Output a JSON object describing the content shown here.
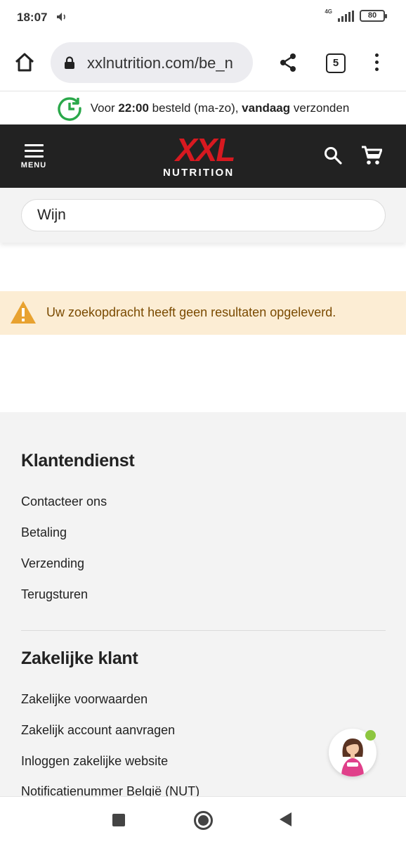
{
  "status_bar": {
    "time": "18:07",
    "network": "4G",
    "battery": "80",
    "icons": [
      "volume-icon",
      "signal-icon",
      "battery-icon"
    ]
  },
  "browser": {
    "url": "xxlnutrition.com/be_n",
    "tab_count": "5",
    "icons": [
      "home-icon",
      "lock-icon",
      "share-icon",
      "tabs-icon",
      "more-icon"
    ]
  },
  "shipping_banner": {
    "prefix": "Voor ",
    "time": "22:00",
    "middle": " besteld (ma-zo), ",
    "emphasis": "vandaag",
    "suffix": " verzonden",
    "accent_color": "#2aa84a"
  },
  "header": {
    "menu_label": "MENU",
    "logo_mark": "XXL",
    "logo_text": "NUTRITION",
    "brand_color": "#d71920",
    "background_color": "#222222"
  },
  "search": {
    "value": "Wijn"
  },
  "warning": {
    "message": "Uw zoekopdracht heeft geen resultaten opgeleverd.",
    "background_color": "#fcedd4",
    "icon_color": "#e8a230"
  },
  "footer": {
    "sections": [
      {
        "heading": "Klantendienst",
        "links": [
          "Contacteer ons",
          "Betaling",
          "Verzending",
          "Terugsturen"
        ]
      },
      {
        "heading": "Zakelijke klant",
        "links": [
          "Zakelijke voorwaarden",
          "Zakelijk account aanvragen",
          "Inloggen zakelijke website",
          "Notificatienummer België (NUT)"
        ]
      }
    ]
  },
  "chat": {
    "status_color": "#8dc63f"
  },
  "nav_bar": {
    "icons": [
      "recent-apps-icon",
      "home-button-icon",
      "back-icon"
    ]
  }
}
